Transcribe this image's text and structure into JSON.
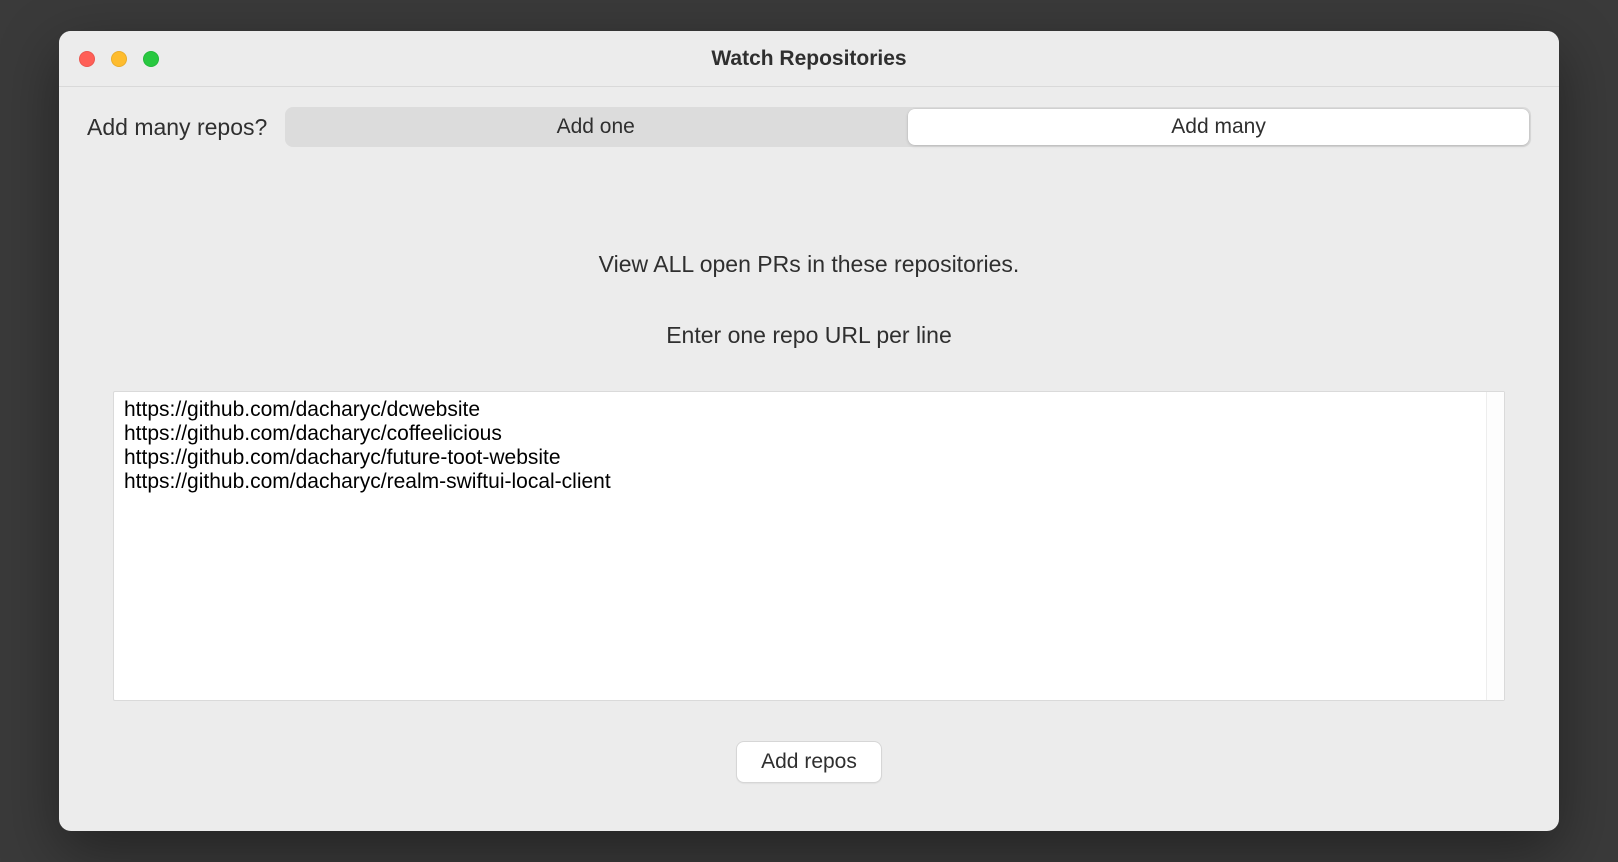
{
  "window": {
    "title": "Watch Repositories"
  },
  "toolbar": {
    "prompt_label": "Add many repos?",
    "segment_one": "Add one",
    "segment_many": "Add many"
  },
  "main": {
    "heading": "View ALL open PRs in these repositories.",
    "subheading": "Enter one repo URL per line",
    "textarea_value": "https://github.com/dacharyc/dcwebsite\nhttps://github.com/dacharyc/coffeelicious\nhttps://github.com/dacharyc/future-toot-website\nhttps://github.com/dacharyc/realm-swiftui-local-client",
    "submit_label": "Add repos"
  }
}
